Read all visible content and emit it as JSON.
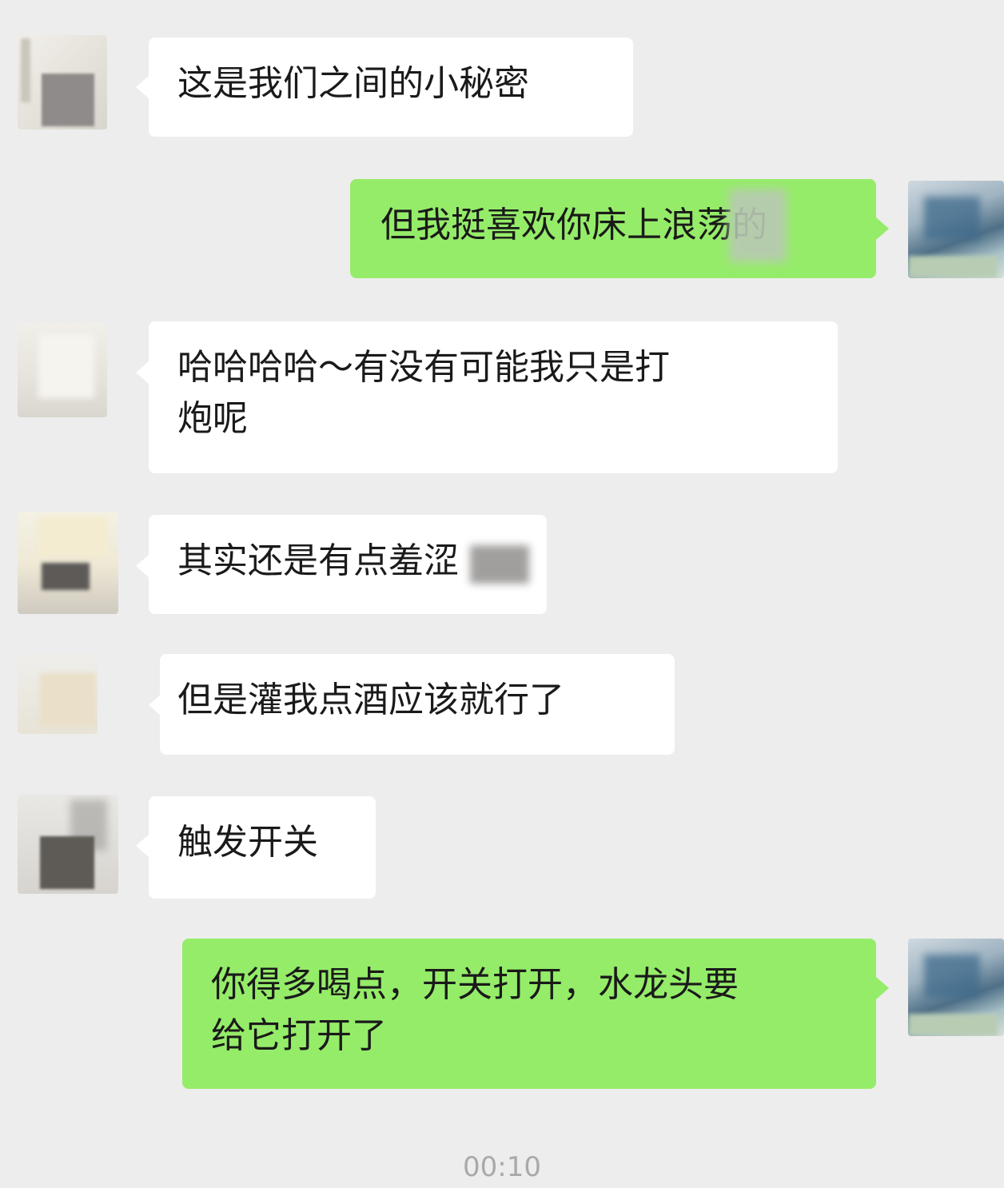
{
  "chat": {
    "messages": [
      {
        "direction": "incoming",
        "text": "这是我们之间的小秘密"
      },
      {
        "direction": "outgoing",
        "text": "但我挺喜欢你床上浪荡的"
      },
      {
        "direction": "incoming",
        "text": "哈哈哈哈～有没有可能我只是打\n炮呢"
      },
      {
        "direction": "incoming",
        "text": "其实还是有点羞涩"
      },
      {
        "direction": "incoming",
        "text": "但是灌我点酒应该就行了"
      },
      {
        "direction": "incoming",
        "text": "触发开关"
      },
      {
        "direction": "outgoing",
        "text": "你得多喝点，开关打开，水龙头要\n给它打开了"
      }
    ],
    "timestamp": "00:10"
  },
  "colors": {
    "background": "#ededed",
    "incoming_bubble": "#ffffff",
    "outgoing_bubble": "#95ec69",
    "timestamp_text": "#a9a9a9"
  }
}
